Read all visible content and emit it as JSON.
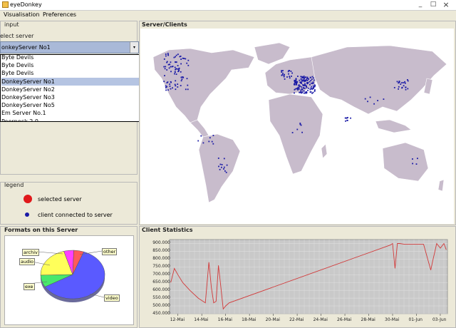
{
  "window": {
    "title": "eyeDonkey",
    "minimize": "_",
    "maximize": "□",
    "close": "×"
  },
  "menu": [
    "Visualisation",
    "Preferences"
  ],
  "input": {
    "title": "input",
    "select_label": "elect server",
    "selected_server": "onkeyServer No1",
    "arrow": "▾",
    "servers": [
      "Byte Devils",
      "Byte Devils",
      "Byte Devils",
      "DonkeyServer No1",
      "DonkeyServer No2",
      "DonkeyServer No3",
      "DonkeyServer No5",
      "Em Server No.1",
      "Peerpeck 2.0"
    ],
    "selected_index": 3,
    "scroll_up": "▲",
    "scroll_down": "▼"
  },
  "legend": {
    "title": "legend",
    "selected_label": "selected server",
    "client_label": "client connected to server",
    "colors": {
      "selected": "#e0191b",
      "client": "#1a1aa6"
    }
  },
  "map_panel": {
    "title": "Server/Clients"
  },
  "formats": {
    "title": "Formats on this Server",
    "labels": {
      "archiv": "archiv",
      "audio": "audio",
      "exe": "exe",
      "other": "other",
      "video": "video"
    }
  },
  "stats": {
    "title": "Client Statistics"
  },
  "chart_data": [
    {
      "type": "pie",
      "title": "Formats on this Server",
      "categories": [
        "video",
        "exe",
        "audio",
        "archiv",
        "other"
      ],
      "values": [
        61,
        8,
        21,
        5,
        5
      ],
      "colors": [
        "#5a5aff",
        "#48e86c",
        "#ffff5a",
        "#ff40ff",
        "#ff5a5a"
      ]
    },
    {
      "type": "line",
      "title": "Client Statistics",
      "xlabels": [
        "12-Mai",
        "14-Mai",
        "16-Mai",
        "18-Mai",
        "20-Mai",
        "22-Mai",
        "24-Mai",
        "26-Mai",
        "28-Mai",
        "30-Mai",
        "01-Jun",
        "03-Jun"
      ],
      "ytick_labels": [
        "900.000",
        "850.000",
        "800.000",
        "750.000",
        "700.000",
        "650.000",
        "600.000",
        "550.000",
        "500.000",
        "450.000"
      ],
      "ylim": [
        450000,
        925000
      ],
      "xlim": [
        11.3,
        34.6
      ],
      "line_color": "#d23a3a",
      "series": [
        {
          "x": [
            11.4,
            11.7,
            12.0,
            12.4,
            13.0,
            13.7,
            14.3,
            14.6,
            14.8,
            15.0,
            15.2,
            15.4,
            15.6,
            15.8,
            16.0,
            16.3,
            29.8,
            30.0,
            30.2,
            30.4,
            30.6,
            31.0,
            32.6,
            33.2,
            33.4,
            33.7,
            34.0,
            34.3,
            34.5
          ],
          "y": [
            650000,
            740000,
            700000,
            650000,
            600000,
            550000,
            520000,
            780000,
            620000,
            520000,
            530000,
            760000,
            620000,
            480000,
            500000,
            520000,
            890000,
            900000,
            740000,
            900000,
            900000,
            895000,
            895000,
            730000,
            800000,
            900000,
            870000,
            900000,
            860000
          ]
        }
      ]
    }
  ]
}
